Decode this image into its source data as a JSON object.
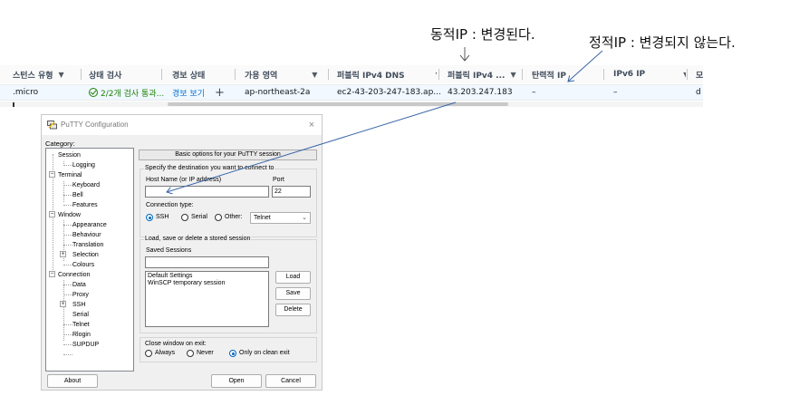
{
  "annotations": {
    "dynamic_ip": "동적IP : 변경된다.",
    "static_ip": "정적IP : 변경되지 않는다."
  },
  "aws_table": {
    "headers": [
      "스턴스 유형",
      "상태 검사",
      "경보 상태",
      "가용 영역",
      "퍼블릭 IPv4 DNS",
      "퍼블릭 IPv4 ...",
      "탄력적 IP",
      "IPv6 IP",
      "모"
    ],
    "row": {
      "instance_type": ".micro",
      "status_check": "2/2개 검사 통과...",
      "alarm_status": "경보 보기",
      "alarm_add": "+",
      "availability_zone": "ap-northeast-2a",
      "public_dns": "ec2-43-203-247-183.ap...",
      "public_ipv4": "43.203.247.183",
      "elastic_ip": "–",
      "ipv6": "–",
      "extra": "d"
    }
  },
  "putty": {
    "title": "PuTTY Configuration",
    "close": "×",
    "category_label": "Category:",
    "tree": [
      "Session",
      "Logging",
      "Terminal",
      "Keyboard",
      "Bell",
      "Features",
      "Window",
      "Appearance",
      "Behaviour",
      "Translation",
      "Selection",
      "Colours",
      "Connection",
      "Data",
      "Proxy",
      "SSH",
      "Serial",
      "Telnet",
      "Rlogin",
      "SUPDUP"
    ],
    "header": "Basic options for your PuTTY session",
    "dest_group": "Specify the destination you want to connect to",
    "host_label": "Host Name (or IP address)",
    "host_value": "",
    "port_label": "Port",
    "port_value": "22",
    "conn_type_label": "Connection type:",
    "conn_types": [
      "SSH",
      "Serial",
      "Other:"
    ],
    "other_select": "Telnet",
    "sessions_group": "Load, save or delete a stored session",
    "saved_label": "Saved Sessions",
    "saved_input": "",
    "sessions_list": [
      "Default Settings",
      "WinSCP temporary session"
    ],
    "load": "Load",
    "save": "Save",
    "delete": "Delete",
    "close_label": "Close window on exit:",
    "close_opts": [
      "Always",
      "Never",
      "Only on clean exit"
    ],
    "about": "About",
    "open": "Open",
    "cancel": "Cancel"
  }
}
